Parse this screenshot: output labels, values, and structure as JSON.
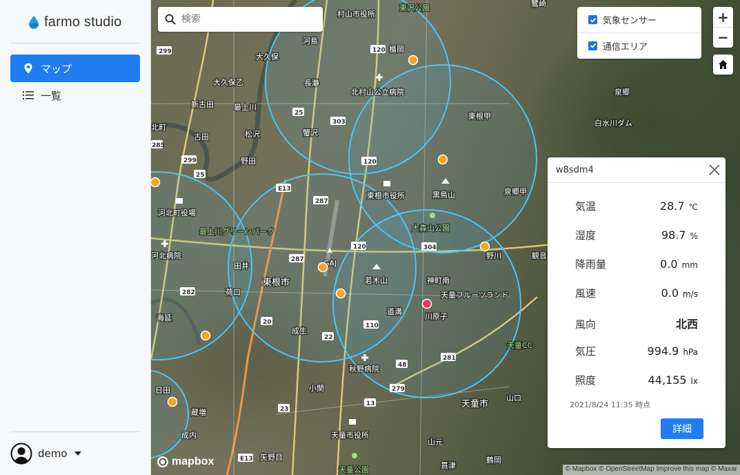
{
  "app": {
    "name": "farmo studio"
  },
  "sidebar": {
    "nav": [
      {
        "label": "マップ",
        "icon": "map-pin-icon",
        "active": true
      },
      {
        "label": "一覧",
        "icon": "list-icon",
        "active": false
      }
    ],
    "user": {
      "name": "demo"
    }
  },
  "map": {
    "search_placeholder": "検索",
    "layers": [
      {
        "label": "気象センサー",
        "checked": true
      },
      {
        "label": "通信エリア",
        "checked": true
      }
    ],
    "zoom_in": "+",
    "zoom_out": "−",
    "logo_text": "mapbox",
    "attribution": "© Mapbox © OpenStreetMap Improve this map © Maxar",
    "place_labels": [
      "東沢公園",
      "村山市役所",
      "河島",
      "大久保",
      "大久保乙",
      "北村山公立病院",
      "長瀞",
      "新古田",
      "最上川",
      "楯岡",
      "東根甲",
      "泉郷",
      "白水川ダム",
      "北町",
      "古田",
      "松沢",
      "蟹沢",
      "野田",
      "東根市役所",
      "黒鳥山",
      "泉郷甲",
      "河北町役場",
      "最上川グリーンパーク",
      "大森山公園",
      "河北病院",
      "田井",
      "GAJ",
      "若木山",
      "東根市",
      "神町南",
      "天童フルーツランド",
      "野川",
      "観音",
      "荷口",
      "道満",
      "川原子",
      "成生",
      "海延",
      "天童CC",
      "秋野病院",
      "日田",
      "小関",
      "天童市",
      "山口",
      "蔵増",
      "成内",
      "矢野目",
      "天童市役所",
      "山元",
      "鶴岡",
      "貫津",
      "天童公園",
      "鷺崎"
    ],
    "road_numbers": [
      "299",
      "120",
      "25",
      "303",
      "120",
      "285",
      "299",
      "25",
      "E13",
      "287",
      "120",
      "304",
      "287",
      "282",
      "20",
      "22",
      "110",
      "48",
      "281",
      "279",
      "13",
      "23",
      "E13"
    ],
    "sensor_colors": {
      "normal": "#f5a623",
      "alert": "#e8345a",
      "area": "#4fc3f7"
    }
  },
  "popup": {
    "id": "w8sdm4",
    "metrics": [
      {
        "label": "気温",
        "value": "28.7",
        "unit": "℃"
      },
      {
        "label": "湿度",
        "value": "98.7",
        "unit": "%"
      },
      {
        "label": "降雨量",
        "value": "0.0",
        "unit": "mm"
      },
      {
        "label": "風速",
        "value": "0.0",
        "unit": "m/s"
      },
      {
        "label": "風向",
        "value": "北西",
        "unit": ""
      },
      {
        "label": "気圧",
        "value": "994.9",
        "unit": "hPa"
      },
      {
        "label": "照度",
        "value": "44,155",
        "unit": "lx"
      }
    ],
    "timestamp": "2021/8/24 11:35 時点",
    "detail_label": "詳細"
  }
}
